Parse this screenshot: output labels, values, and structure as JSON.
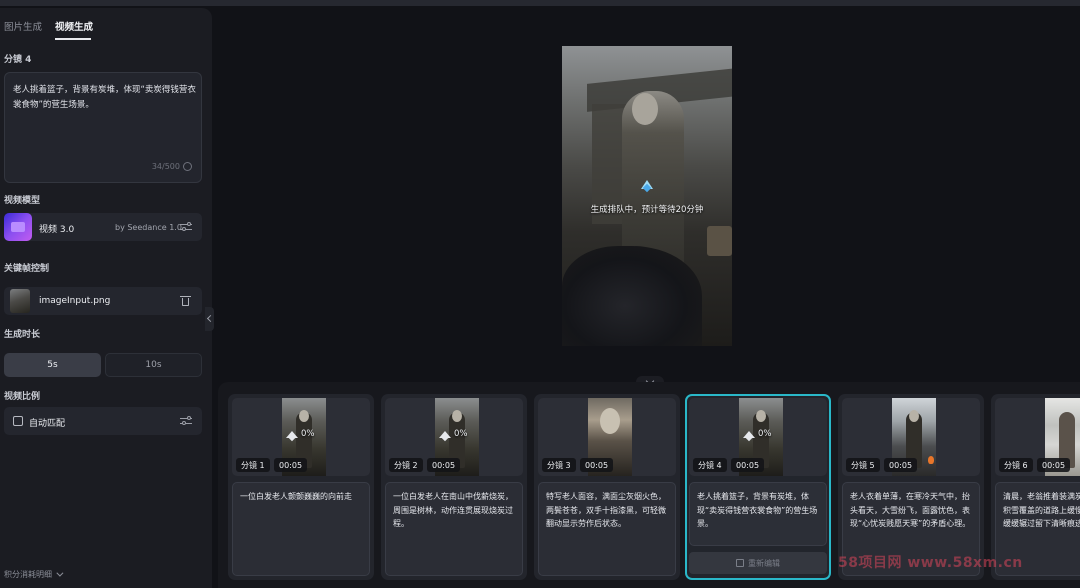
{
  "tabs": [
    {
      "label": "图片生成"
    },
    {
      "label": "视频生成"
    }
  ],
  "prompt": {
    "section_label": "分镜 4",
    "text": "老人挑着篮子，背景有炭堆，体现“卖炭得钱营衣裳食物”的营生场景。",
    "counter": "34/500"
  },
  "model": {
    "section_label": "视频模型",
    "name": "视频 3.0",
    "provider": "by Seedance 1.0"
  },
  "keyframe": {
    "section_label": "关键帧控制",
    "filename": "imageInput.png"
  },
  "duration": {
    "section_label": "生成时长",
    "options": [
      "5s",
      "10s"
    ],
    "selected": "5s"
  },
  "ratio": {
    "section_label": "视频比例",
    "value": "自动匹配"
  },
  "credits_label": "积分消耗明细",
  "preview": {
    "status": "生成排队中，预计等待20分钟"
  },
  "storyboards": [
    {
      "label": "分镜 1",
      "duration": "00:05",
      "progress": "0%",
      "description": "一位白发老人颤颤巍巍的向前走"
    },
    {
      "label": "分镜 2",
      "duration": "00:05",
      "progress": "0%",
      "description": "一位白发老人在南山中伐薪烧炭，周围是树林，动作连贯展现烧炭过程。"
    },
    {
      "label": "分镜 3",
      "duration": "00:05",
      "progress": "",
      "description": "特写老人面容，满面尘灰烟火色，两鬓苍苍，双手十指漆黑，可轻微翻动显示劳作后状态。"
    },
    {
      "label": "分镜 4",
      "duration": "00:05",
      "progress": "0%",
      "description": "老人挑着篮子，背景有炭堆，体现“卖炭得钱营衣裳食物”的营生场景。",
      "selected": true,
      "action": "重新编辑"
    },
    {
      "label": "分镜 5",
      "duration": "00:05",
      "progress": "",
      "description": "老人衣着单薄，在寒冷天气中，抬头看天，大雪纷飞，面露忧色，表现“心忧炭贱愿天寒”的矛盾心理。"
    },
    {
      "label": "分镜 6",
      "duration": "00:05",
      "progress": "",
      "description": "清晨，老翁推着装满炭的牛车，在积雪覆盖的道路上缓慢前进，车轮缓缓辗过留下清晰痕迹。"
    }
  ],
  "watermark": "58项目网 www.58xm.cn",
  "colors": {
    "accent": "#2ab8c9",
    "background": "#111217",
    "panel": "#1b1c22"
  }
}
